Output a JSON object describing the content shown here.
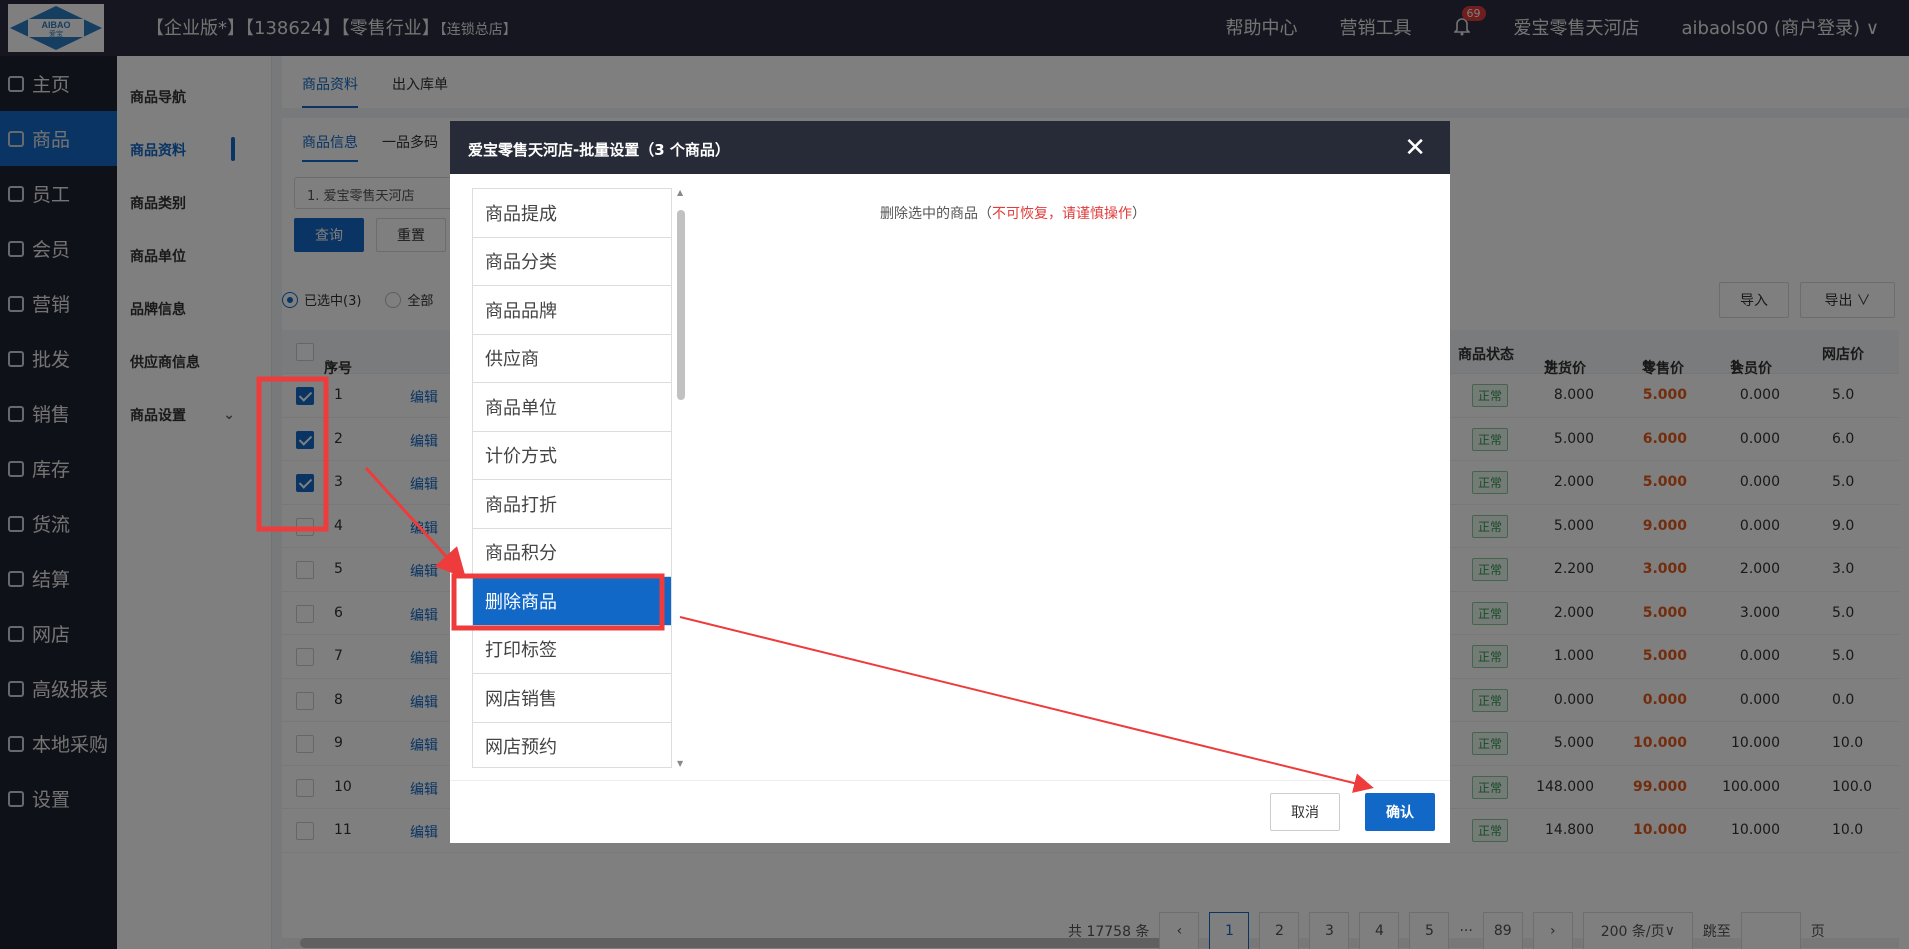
{
  "topbar": {
    "logo_top": "AIBAO",
    "logo_bottom": "爱宝",
    "edition": "【企业版*】【138624】【零售行业】",
    "store_type": "【连锁总店】",
    "help": "帮助中心",
    "marketing": "营销工具",
    "notif_count": "69",
    "store_name": "爱宝零售天河店",
    "user": "aibaols00 (商户登录)"
  },
  "sidebar": {
    "items": [
      {
        "label": "主页"
      },
      {
        "label": "商品"
      },
      {
        "label": "员工"
      },
      {
        "label": "会员"
      },
      {
        "label": "营销"
      },
      {
        "label": "批发"
      },
      {
        "label": "销售"
      },
      {
        "label": "库存"
      },
      {
        "label": "货流"
      },
      {
        "label": "结算"
      },
      {
        "label": "网店"
      },
      {
        "label": "高级报表"
      },
      {
        "label": "本地采购"
      },
      {
        "label": "设置"
      }
    ]
  },
  "subnav": {
    "items": [
      {
        "label": "商品导航"
      },
      {
        "label": "商品资料"
      },
      {
        "label": "商品类别"
      },
      {
        "label": "商品单位"
      },
      {
        "label": "品牌信息"
      },
      {
        "label": "供应商信息"
      },
      {
        "label": "商品设置"
      }
    ]
  },
  "main": {
    "tab_info": "商品资料",
    "tab_stock": "出入库单",
    "subtab_info": "商品信息",
    "subtab_multi": "一品多码",
    "store_filter": "1. 爱宝零售天河店",
    "query": "查询",
    "reset": "重置",
    "radio_selected": "已选中(3)",
    "radio_all": "全部",
    "import": "导入",
    "export": "导出"
  },
  "table": {
    "headers": {
      "seq": "序号",
      "status": "商品状态",
      "purchase": "进货价",
      "retail": "零售价",
      "member": "会员价",
      "online": "网店价"
    },
    "edit_label": "编辑",
    "status_label": "正常",
    "rows": [
      {
        "seq": "1",
        "purchase": "8.000",
        "retail": "5.000",
        "member": "0.000",
        "online": "5.0"
      },
      {
        "seq": "2",
        "purchase": "5.000",
        "retail": "6.000",
        "member": "0.000",
        "online": "6.0"
      },
      {
        "seq": "3",
        "purchase": "2.000",
        "retail": "5.000",
        "member": "0.000",
        "online": "5.0"
      },
      {
        "seq": "4",
        "purchase": "5.000",
        "retail": "9.000",
        "member": "0.000",
        "online": "9.0"
      },
      {
        "seq": "5",
        "purchase": "2.200",
        "retail": "3.000",
        "member": "2.000",
        "online": "3.0"
      },
      {
        "seq": "6",
        "purchase": "2.000",
        "retail": "5.000",
        "member": "3.000",
        "online": "5.0"
      },
      {
        "seq": "7",
        "purchase": "1.000",
        "retail": "5.000",
        "member": "0.000",
        "online": "5.0"
      },
      {
        "seq": "8",
        "purchase": "0.000",
        "retail": "0.000",
        "member": "0.000",
        "online": "0.0"
      },
      {
        "seq": "9",
        "purchase": "5.000",
        "retail": "10.000",
        "member": "10.000",
        "online": "10.0"
      },
      {
        "seq": "10",
        "purchase": "148.000",
        "retail": "99.000",
        "member": "100.000",
        "online": "100.0"
      },
      {
        "seq": "11",
        "purchase": "14.800",
        "retail": "10.000",
        "member": "10.000",
        "online": "10.0"
      }
    ]
  },
  "pager": {
    "total": "共 17758 条",
    "pages": [
      "1",
      "2",
      "3",
      "4",
      "5"
    ],
    "ellipsis": "···",
    "last": "89",
    "size": "200 条/页",
    "jump": "跳至",
    "page_unit": "页"
  },
  "modal": {
    "title": "爱宝零售天河店-批量设置（3 个商品）",
    "items": [
      {
        "label": "商品提成"
      },
      {
        "label": "商品分类"
      },
      {
        "label": "商品品牌"
      },
      {
        "label": "供应商"
      },
      {
        "label": "商品单位"
      },
      {
        "label": "计价方式"
      },
      {
        "label": "商品打折"
      },
      {
        "label": "商品积分"
      },
      {
        "label": "删除商品"
      },
      {
        "label": "打印标签"
      },
      {
        "label": "网店销售"
      },
      {
        "label": "网店预约"
      }
    ],
    "desc": "删除选中的商品（",
    "warning": "不可恢复，请谨慎操作",
    "desc_end": "）",
    "cancel": "取消",
    "confirm": "确认"
  },
  "colors": {
    "primary": "#1268c6",
    "topbar": "#2b2d3e",
    "sidebar": "#1f2230",
    "annotation": "#ee3b3b"
  }
}
